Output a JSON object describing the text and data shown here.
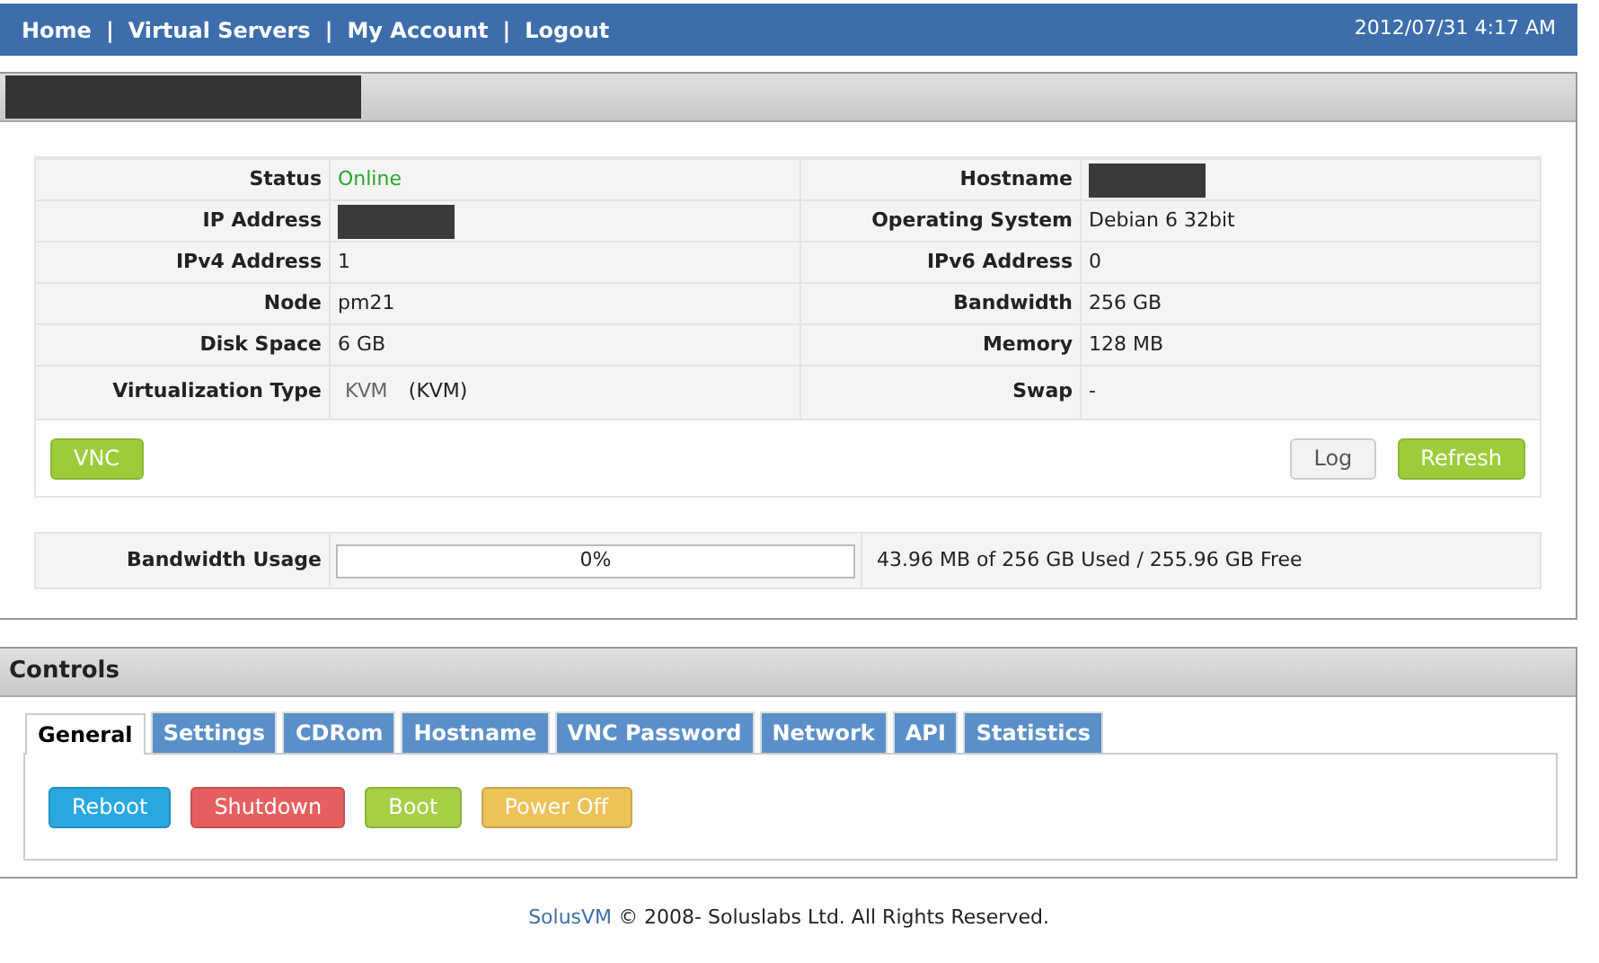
{
  "nav": {
    "links": [
      {
        "label": "Home"
      },
      {
        "label": "Virtual Servers"
      },
      {
        "label": "My Account"
      },
      {
        "label": "Logout"
      }
    ],
    "separator": "|",
    "datetime": "2012/07/31 4:17 AM"
  },
  "server_panel": {
    "title_redacted": true,
    "rows": [
      {
        "left": {
          "label": "Status",
          "value": "Online",
          "kind": "status"
        },
        "right": {
          "label": "Hostname",
          "kind": "redacted"
        }
      },
      {
        "left": {
          "label": "IP Address",
          "kind": "redacted"
        },
        "right": {
          "label": "Operating System",
          "value": "Debian 6 32bit",
          "kind": "text"
        }
      },
      {
        "left": {
          "label": "IPv4 Address",
          "value": "1",
          "kind": "text"
        },
        "right": {
          "label": "IPv6 Address",
          "value": "0",
          "kind": "text"
        }
      },
      {
        "left": {
          "label": "Node",
          "value": "pm21",
          "kind": "text"
        },
        "right": {
          "label": "Bandwidth",
          "value": "256 GB",
          "kind": "text"
        }
      },
      {
        "left": {
          "label": "Disk Space",
          "value": "6 GB",
          "kind": "text"
        },
        "right": {
          "label": "Memory",
          "value": "128 MB",
          "kind": "text"
        }
      },
      {
        "left": {
          "label": "Virtualization Type",
          "logo_text": "KVM",
          "value": "(KVM)",
          "kind": "virt"
        },
        "right": {
          "label": "Swap",
          "value": "-",
          "kind": "text"
        }
      }
    ],
    "left_buttons": [
      {
        "label": "VNC",
        "color": "#9ccc3a"
      }
    ],
    "right_buttons": [
      {
        "label": "Log",
        "color": "#f2f2f2"
      },
      {
        "label": "Refresh",
        "color": "#9ccc3a"
      }
    ],
    "bandwidth": {
      "label": "Bandwidth Usage",
      "level": 0,
      "reading": "0%",
      "summary": "43.96 MB of 256 GB Used / 255.96 GB Free"
    }
  },
  "controls": {
    "title": "Controls",
    "tabs": [
      {
        "label": "General",
        "selected": true
      },
      {
        "label": "Settings",
        "selected": false
      },
      {
        "label": "CDRom",
        "selected": false
      },
      {
        "label": "Hostname",
        "selected": false
      },
      {
        "label": "VNC Password",
        "selected": false
      },
      {
        "label": "Network",
        "selected": false
      },
      {
        "label": "API",
        "selected": false
      },
      {
        "label": "Statistics",
        "selected": false
      }
    ],
    "buttons": [
      {
        "label": "Reboot",
        "color": "#29a8e0"
      },
      {
        "label": "Shutdown",
        "color": "#e65f5f"
      },
      {
        "label": "Boot",
        "color": "#a6cf45"
      },
      {
        "label": "Power Off",
        "color": "#edc259"
      }
    ]
  },
  "footer": {
    "brand": "SolusVM",
    "text": "© 2008- Soluslabs Ltd. All Rights Reserved."
  }
}
